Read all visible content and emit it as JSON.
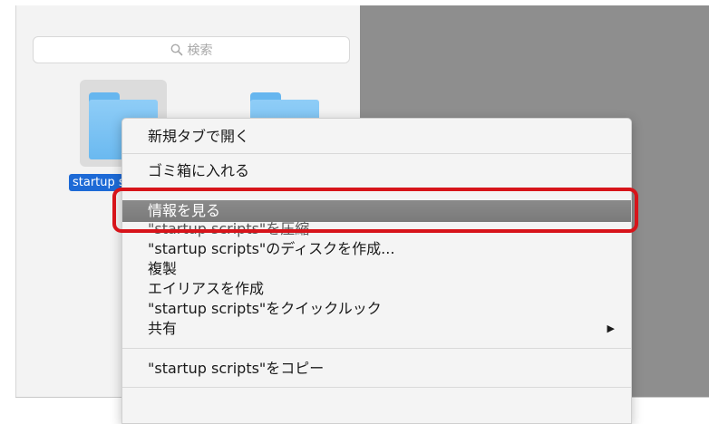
{
  "search": {
    "placeholder": "検索"
  },
  "selected_file": {
    "label": "startup scripts"
  },
  "context_menu": {
    "items": [
      {
        "label": "新規タブで開く"
      },
      {
        "label": "ゴミ箱に入れる"
      },
      {
        "label": "情報を見る"
      },
      {
        "label": "\"startup scripts\"を圧縮"
      },
      {
        "label": "\"startup scripts\"のディスクを作成..."
      },
      {
        "label": "複製"
      },
      {
        "label": "エイリアスを作成"
      },
      {
        "label": "\"startup scripts\"をクイックルック"
      },
      {
        "label": "共有"
      },
      {
        "label": "\"startup scripts\"をコピー"
      }
    ],
    "highlighted_index": 2
  },
  "icons": {
    "search": "magnifier-icon",
    "folder": "folder-icon",
    "submenu": "submenu-arrow-icon"
  },
  "colors": {
    "highlight_callout": "#d7141a",
    "selection_label": "#1d6ad6",
    "folder": "#6ab9f0",
    "desktop": "#8e8e8e"
  }
}
